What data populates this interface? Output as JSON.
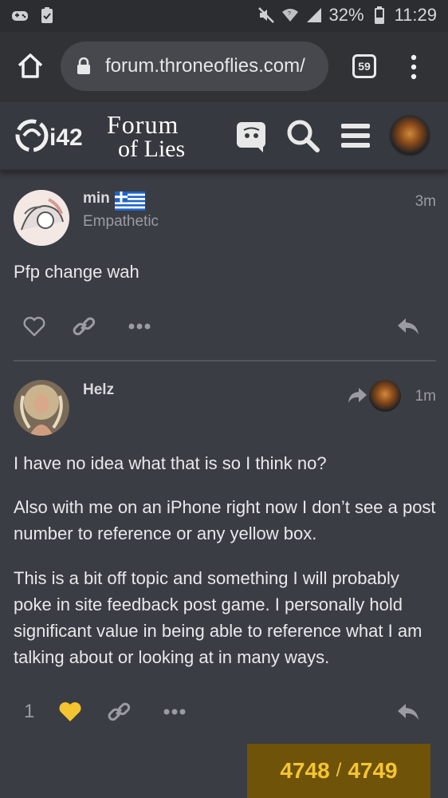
{
  "statusbar": {
    "battery": "32%",
    "time": "11:29"
  },
  "browser": {
    "url": "forum.throneoflies.com/",
    "tab_count": "59"
  },
  "site": {
    "logo_text": "i42",
    "brand_line1": "Forum",
    "brand_line2": "of Lies"
  },
  "posts": [
    {
      "username": "min",
      "user_title": "Empathetic",
      "time": "3m",
      "flag": "greece-flag-icon",
      "paragraphs": [
        "Pfp change wah"
      ]
    },
    {
      "username": "Helz",
      "time": "1m",
      "paragraphs": [
        "I have no idea what that is so I think no?",
        "Also with me on an iPhone right now I don’t see a post number to reference or any yellow box.",
        "This is a bit off topic and something I will probably poke in site feedback post game. I personally hold significant value in being able to reference what I am talking about or looking at in many ways."
      ],
      "like_count": "1"
    }
  ],
  "progress": {
    "current": "4748",
    "separator": "/",
    "total": "4749"
  },
  "colors": {
    "background": "#3a3d44",
    "liked_heart": "#f4c531",
    "progress_bg": "#6e5308"
  }
}
